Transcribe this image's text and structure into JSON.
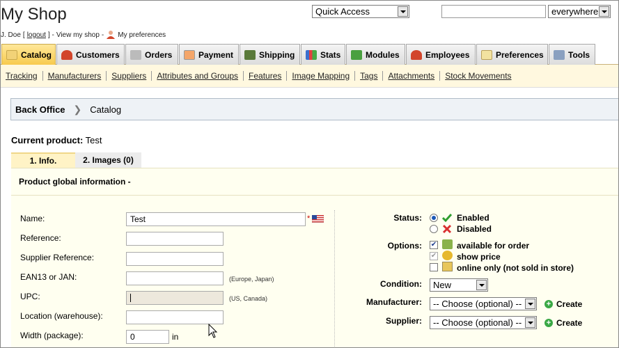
{
  "header": {
    "title": "My Shop",
    "user": "J. Doe",
    "logout": "logout",
    "view_shop": "View my shop",
    "preferences": "My preferences",
    "quick_access": "Quick Access",
    "search_scope": "everywhere",
    "search_value": ""
  },
  "tabs": [
    {
      "label": "Catalog",
      "icon": "catalog-icon",
      "active": true
    },
    {
      "label": "Customers",
      "icon": "customers-icon"
    },
    {
      "label": "Orders",
      "icon": "orders-icon"
    },
    {
      "label": "Payment",
      "icon": "payment-icon"
    },
    {
      "label": "Shipping",
      "icon": "shipping-icon"
    },
    {
      "label": "Stats",
      "icon": "stats-icon"
    },
    {
      "label": "Modules",
      "icon": "modules-icon"
    },
    {
      "label": "Employees",
      "icon": "employees-icon"
    },
    {
      "label": "Preferences",
      "icon": "preferences-icon"
    },
    {
      "label": "Tools",
      "icon": "tools-icon"
    }
  ],
  "subnav": [
    "Tracking",
    "Manufacturers",
    "Suppliers",
    "Attributes and Groups",
    "Features",
    "Image Mapping",
    "Tags",
    "Attachments",
    "Stock Movements"
  ],
  "breadcrumb": {
    "root": "Back Office",
    "current": "Catalog"
  },
  "product": {
    "current_label": "Current product:",
    "current_name": "Test",
    "tab_info": "1. Info.",
    "tab_images": "2. Images (0)",
    "panel_title": "Product global information -"
  },
  "form": {
    "name_label": "Name:",
    "name_value": "Test",
    "reference_label": "Reference:",
    "supplier_ref_label": "Supplier Reference:",
    "ean_label": "EAN13 or JAN:",
    "ean_hint": "(Europe, Japan)",
    "upc_label": "UPC:",
    "upc_hint": "(US, Canada)",
    "location_label": "Location (warehouse):",
    "width_label": "Width (package):",
    "width_value": "0",
    "width_unit": "in",
    "required_mark": "*"
  },
  "right": {
    "status_label": "Status:",
    "enabled": "Enabled",
    "disabled": "Disabled",
    "options_label": "Options:",
    "opt_available": "available for order",
    "opt_show_price": "show price",
    "opt_online_only": "online only (not sold in store)",
    "condition_label": "Condition:",
    "condition_value": "New",
    "manufacturer_label": "Manufacturer:",
    "manufacturer_value": "-- Choose (optional) --",
    "supplier_label": "Supplier:",
    "supplier_value": "-- Choose (optional) --",
    "create_label": "Create"
  },
  "colors": {
    "active_tab": "#f7c94b",
    "panel_bg": "#fffff0",
    "subnav_bg": "#fff8df"
  }
}
